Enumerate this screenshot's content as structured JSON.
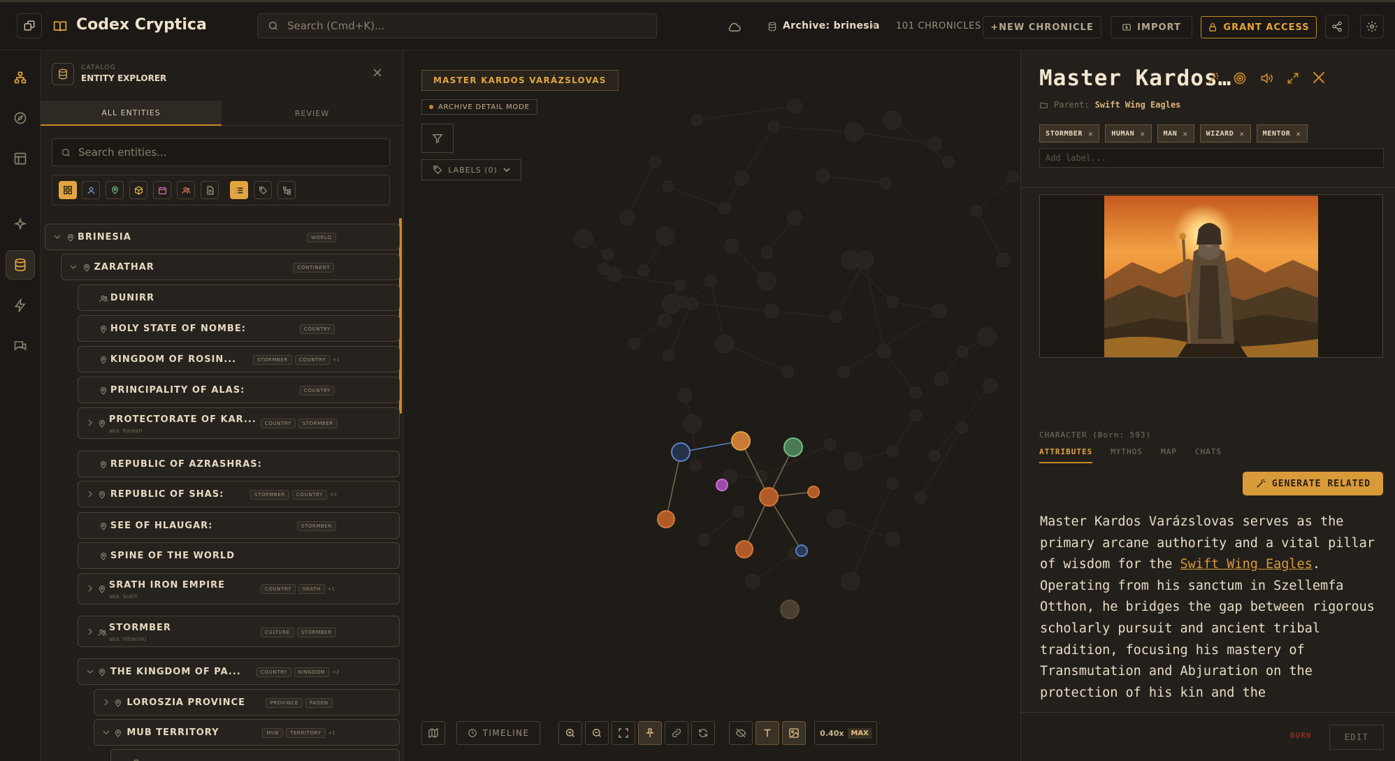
{
  "app": {
    "title": "Codex Cryptica",
    "search_placeholder": "Search (Cmd+K)...",
    "archive_label": "Archive: brinesia",
    "chronicles_count": "101 CHRONICLES",
    "new_chronicle": "+NEW CHRONICLE",
    "import": "IMPORT",
    "grant_access": "GRANT ACCESS"
  },
  "colors": {
    "accent": "#e0a440",
    "background": "#1f1b17",
    "panel": "#231f1b",
    "burn": "#8e2a22"
  },
  "rail": {
    "items": [
      {
        "icon": "graph-icon",
        "active": false
      },
      {
        "icon": "compass-icon",
        "active": false
      },
      {
        "icon": "layout-icon",
        "active": false
      },
      {
        "icon": "sparkles-icon",
        "active": false
      },
      {
        "icon": "database-icon",
        "active": true
      },
      {
        "icon": "bolt-icon",
        "active": false
      },
      {
        "icon": "chat-icon",
        "active": false
      }
    ]
  },
  "explorer": {
    "kicker": "CATALOG",
    "title": "ENTITY EXPLORER",
    "tabs": [
      "ALL ENTITIES",
      "REVIEW"
    ],
    "search_placeholder": "Search entities...",
    "rows": [
      {
        "name": "BRINESIA",
        "aka": "",
        "tags": [
          "WORLD"
        ],
        "more": "",
        "icon": "pin"
      },
      {
        "name": "ZARATHAR",
        "aka": "",
        "tags": [
          "CONTINENT"
        ],
        "more": "",
        "icon": "pin"
      },
      {
        "name": "DUNIRR",
        "aka": "",
        "tags": [],
        "more": "",
        "icon": "people"
      },
      {
        "name": "HOLY STATE OF NOMBE:",
        "aka": "",
        "tags": [
          "COUNTRY"
        ],
        "more": "",
        "icon": "pin"
      },
      {
        "name": "KINGDOM OF ROSIN...",
        "aka": "",
        "tags": [
          "STORMBER",
          "COUNTRY"
        ],
        "more": "+1",
        "icon": "pin"
      },
      {
        "name": "PRINCIPALITY OF ALAS:",
        "aka": "",
        "tags": [
          "COUNTRY"
        ],
        "more": "",
        "icon": "pin"
      },
      {
        "name": "PROTECTORATE OF KAR...",
        "aka": "aka: Kareeh",
        "tags": [
          "COUNTRY",
          "STORMBER"
        ],
        "more": "",
        "icon": "pin"
      },
      {
        "name": "REPUBLIC OF AZRASHRAS:",
        "aka": "",
        "tags": [],
        "more": "",
        "icon": "pin"
      },
      {
        "name": "REPUBLIC OF SHAS:",
        "aka": "",
        "tags": [
          "STORMBER",
          "COUNTRY"
        ],
        "more": "+1",
        "icon": "pin"
      },
      {
        "name": "SEE OF HLAUGAR:",
        "aka": "",
        "tags": [
          "STORMBER"
        ],
        "more": "",
        "icon": "pin"
      },
      {
        "name": "SPINE OF THE WORLD",
        "aka": "",
        "tags": [],
        "more": "",
        "icon": "pin"
      },
      {
        "name": "SRATH IRON EMPIRE",
        "aka": "aka: Srath",
        "tags": [
          "COUNTRY",
          "SRATH"
        ],
        "more": "+1",
        "icon": "pin"
      },
      {
        "name": "STORMBER",
        "aka": "aka: Viharsiki",
        "tags": [
          "CULTURE",
          "STORMBER"
        ],
        "more": "",
        "icon": "people"
      },
      {
        "name": "THE KINGDOM OF PA...",
        "aka": "",
        "tags": [
          "COUNTRY",
          "KINGDOM"
        ],
        "more": "+2",
        "icon": "pin"
      },
      {
        "name": "LOROSZIA PROVINCE",
        "aka": "",
        "tags": [
          "PROVINCE",
          "PADEN"
        ],
        "more": "",
        "icon": "pin"
      },
      {
        "name": "MUB TERRITORY",
        "aka": "",
        "tags": [
          "MUB",
          "TERRITORY"
        ],
        "more": "+1",
        "icon": "pin"
      },
      {
        "name": "",
        "aka": "",
        "tags": [],
        "more": "",
        "icon": "pin"
      }
    ]
  },
  "graph": {
    "selected_title": "MASTER KARDOS VARÁZSLOVAS",
    "mode": "ARCHIVE DETAIL MODE",
    "labels_button": "LABELS (0)",
    "timeline": "TIMELINE",
    "zoom": "0.40x",
    "zoom_max": "MAX"
  },
  "detail": {
    "title": "Master Kardos…",
    "parent_prefix": "Parent:",
    "parent_name": "Swift Wing Eagles",
    "labels": [
      "STORMBER",
      "HUMAN",
      "MAN",
      "WIZARD",
      "MENTOR"
    ],
    "add_label_placeholder": "Add label...",
    "type_line": "CHARACTER (Born: 593)",
    "tabs": [
      "ATTRIBUTES",
      "MYTHOS",
      "MAP",
      "CHATS"
    ],
    "generate_button": "GENERATE RELATED",
    "body_pre": "Master Kardos Varázslovas serves as the primary arcane authority and a vital pillar of wisdom for the ",
    "body_link": "Swift Wing Eagles",
    "body_post": ". Operating from his sanctum in Szellemfa Otthon, he bridges the gap between rigorous scholarly pursuit and ancient tribal tradition, focusing his mastery of Transmutation and Abjuration on the protection of his kin and the",
    "burn": "BURN",
    "edit": "EDIT"
  }
}
